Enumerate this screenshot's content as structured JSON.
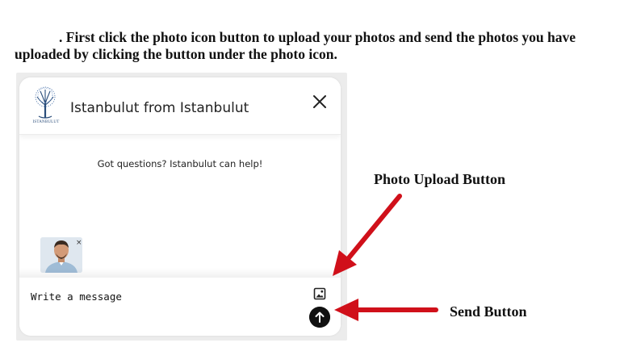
{
  "instructions": {
    "text": ". First click the photo icon button to upload your photos and send the photos you have uploaded by clicking the button under the photo icon."
  },
  "chat_widget": {
    "logo_text": "ISTANBULUT",
    "title": "Istanbulut from Istanbulut",
    "close_icon": "close-icon",
    "welcome_message": "Got questions? Istanbulut can help!",
    "attachment_remove_label": "×",
    "message_placeholder": "Write a message",
    "photo_button_icon": "image-icon",
    "send_button_icon": "arrow-up-icon"
  },
  "annotations": {
    "photo_upload_label": "Photo Upload Button",
    "send_label": "Send Button",
    "arrow_color": "#d0101a"
  }
}
